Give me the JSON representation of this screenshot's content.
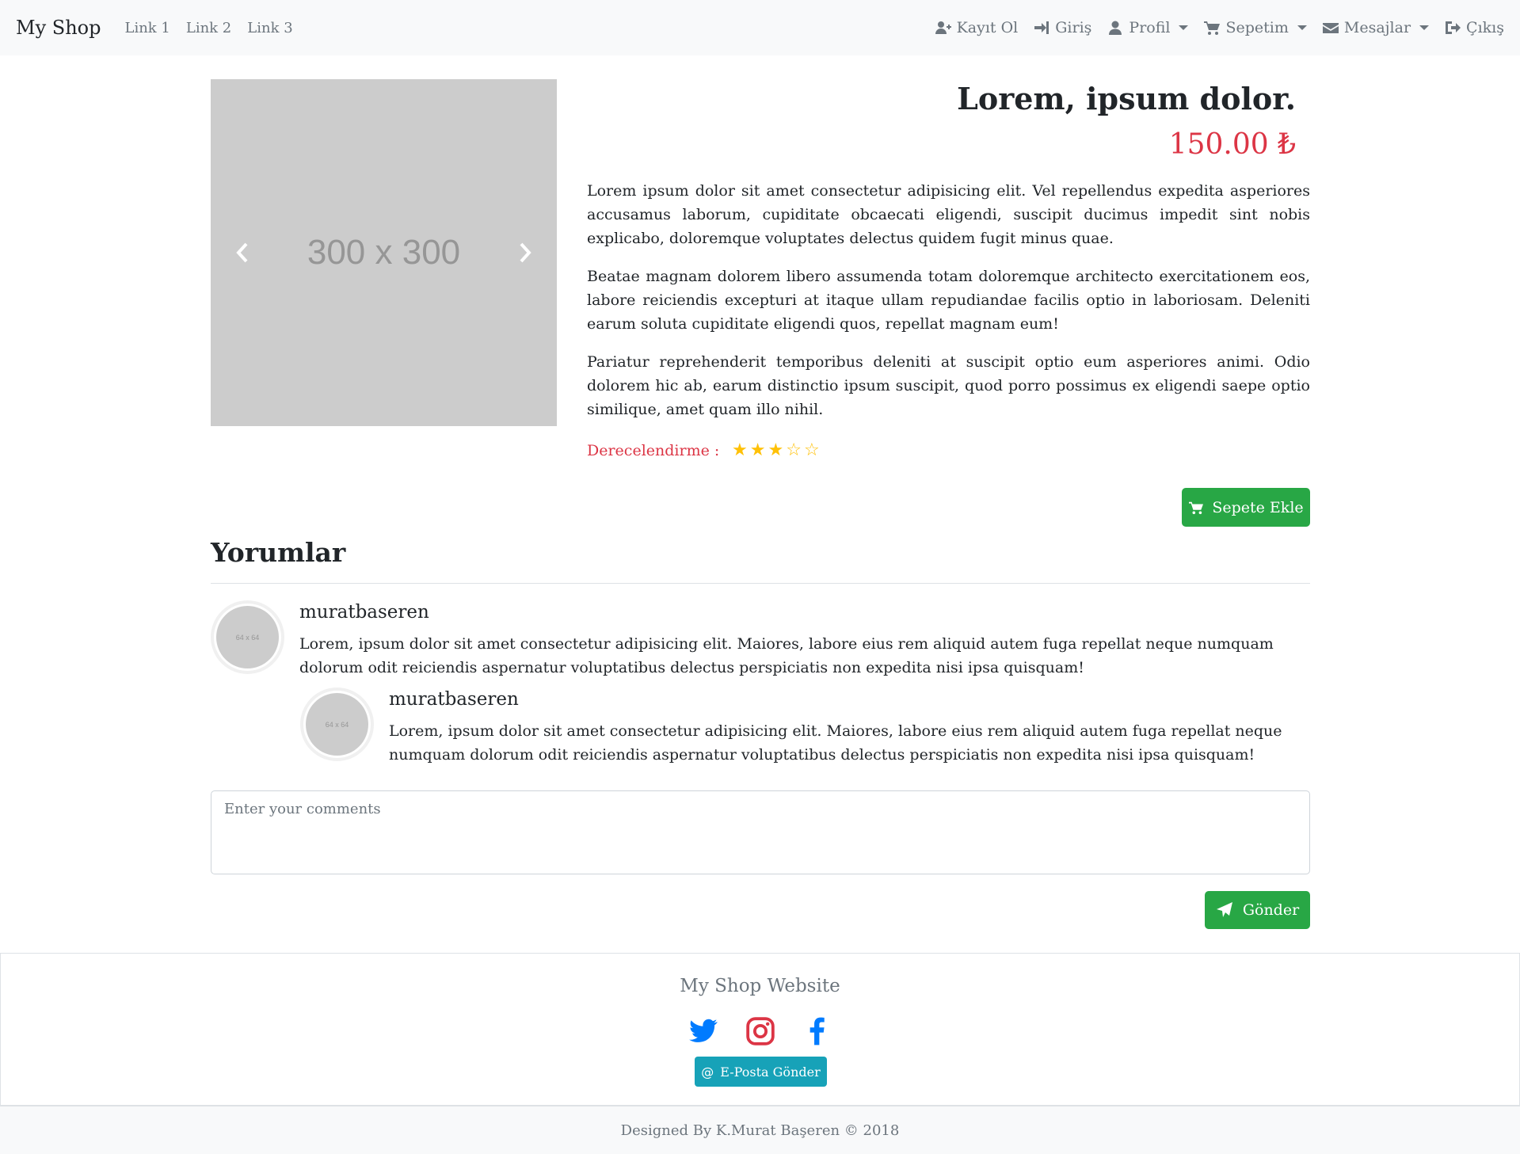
{
  "navbar": {
    "brand": "My Shop",
    "links": [
      "Link 1",
      "Link 2",
      "Link 3"
    ],
    "right": {
      "register": "Kayıt Ol",
      "login": "Giriş",
      "profile": "Profil",
      "cart": "Sepetim",
      "messages": "Mesajlar",
      "logout": "Çıkış"
    }
  },
  "product": {
    "image_placeholder": "300 x 300",
    "title": "Lorem, ipsum dolor.",
    "price": "150.00 ₺",
    "paragraphs": [
      "Lorem ipsum dolor sit amet consectetur adipisicing elit. Vel repellendus expedita asperiores accusamus laborum, cupiditate obcaecati eligendi, suscipit ducimus impedit sint nobis explicabo, doloremque voluptates delectus quidem fugit minus quae.",
      "Beatae magnam dolorem libero assumenda totam doloremque architecto exercitationem eos, labore reiciendis excepturi at itaque ullam repudiandae facilis optio in laboriosam. Deleniti earum soluta cupiditate eligendi quos, repellat magnam eum!",
      "Pariatur reprehenderit temporibus deleniti at suscipit optio eum asperiores animi. Odio dolorem hic ab, earum distinctio ipsum suscipit, quod porro possimus ex eligendi saepe optio similique, amet quam illo nihil."
    ],
    "rating_label": "Derecelendirme :",
    "rating": 3,
    "rating_max": 5,
    "add_to_cart": "Sepete Ekle"
  },
  "comments": {
    "title": "Yorumlar",
    "avatar_placeholder": "64 x 64",
    "items": [
      {
        "author": "muratbaseren",
        "text": "Lorem, ipsum dolor sit amet consectetur adipisicing elit. Maiores, labore eius rem aliquid autem fuga repellat neque numquam dolorum odit reiciendis aspernatur voluptatibus delectus perspiciatis non expedita nisi ipsa quisquam!"
      },
      {
        "author": "muratbaseren",
        "text": "Lorem, ipsum dolor sit amet consectetur adipisicing elit. Maiores, labore eius rem aliquid autem fuga repellat neque numquam dolorum odit reiciendis aspernatur voluptatibus delectus perspiciatis non expedita nisi ipsa quisquam!"
      }
    ],
    "input_placeholder": "Enter your comments",
    "send": "Gönder"
  },
  "footer": {
    "title": "My Shop Website",
    "socials": [
      "twitter-icon",
      "instagram-icon",
      "facebook-icon"
    ],
    "email_button": "E-Posta Gönder",
    "copyright": "Designed By K.Murat Başeren © 2018"
  },
  "colors": {
    "navbar_bg": "#f8f9fa",
    "price": "#dc3545",
    "success": "#28a745",
    "info": "#17a2b8",
    "star": "#ffc107",
    "twitter": "#007bff",
    "instagram": "#dc3545",
    "facebook": "#007bff"
  }
}
